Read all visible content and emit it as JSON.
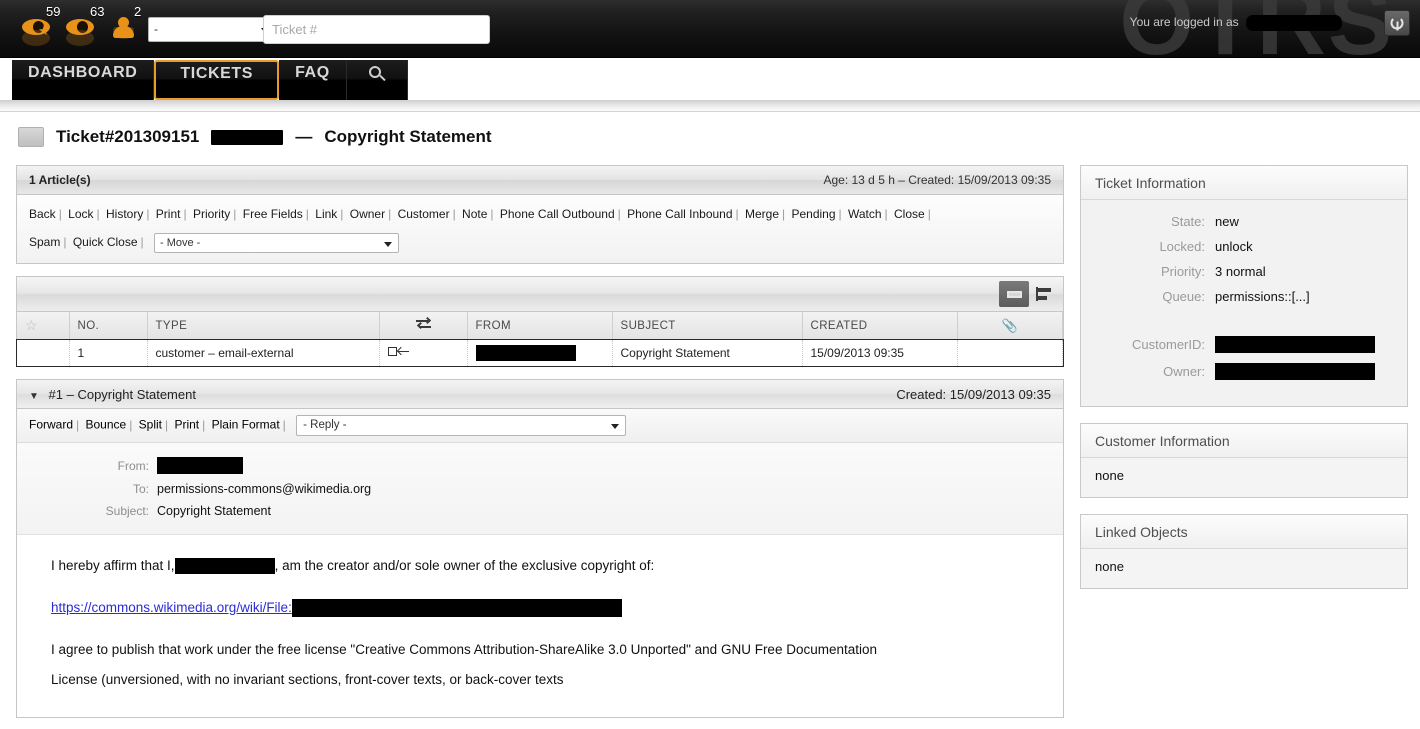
{
  "header": {
    "watermark": "OTRS",
    "toolbar_counts": [
      {
        "icon": "watched-tickets-icon",
        "count": "59"
      },
      {
        "icon": "seen-tickets-icon",
        "count": "63"
      },
      {
        "icon": "my-tickets-icon",
        "count": "2"
      }
    ],
    "queue_select_value": "-",
    "ticket_search_placeholder": "Ticket #",
    "ticket_search_value": "",
    "logged_in_label": "You are logged in as",
    "logged_in_user": "[redacted]"
  },
  "nav": {
    "items": [
      {
        "label": "DASHBOARD",
        "active": false
      },
      {
        "label": "TICKETS",
        "active": true
      },
      {
        "label": "FAQ",
        "active": false
      }
    ],
    "search_label": "Search"
  },
  "page_title": {
    "ticket_prefix": "Ticket#201309151",
    "redacted": "[redacted]",
    "dash": "—",
    "subject": "Copyright Statement"
  },
  "article_widget": {
    "count_label": "1 Article(s)",
    "age_created": "Age: 13 d 5 h – Created: 15/09/2013 09:35",
    "actions_row1": [
      "Back",
      "Lock",
      "History",
      "Print",
      "Priority",
      "Free Fields",
      "Link",
      "Owner",
      "Customer",
      "Note",
      "Phone Call Outbound",
      "Phone Call Inbound",
      "Merge",
      "Pending",
      "Watch",
      "Close"
    ],
    "actions_row2": [
      "Spam",
      "Quick Close"
    ],
    "move_select_value": "- Move -"
  },
  "article_table": {
    "columns": [
      "",
      "NO.",
      "TYPE",
      "",
      "FROM",
      "SUBJECT",
      "CREATED",
      ""
    ],
    "column_icons": [
      "star-icon",
      "",
      "",
      "exchange-icon",
      "",
      "",
      "",
      "paperclip-icon"
    ],
    "rows": [
      {
        "no": "1",
        "type": "customer – email-external",
        "direction_icon": "incoming-message-icon",
        "from": "[redacted]",
        "subject": "Copyright Statement",
        "created": "15/09/2013 09:35",
        "attachment": ""
      }
    ]
  },
  "article_detail": {
    "title": "#1 – Copyright Statement",
    "created": "Created: 15/09/2013 09:35",
    "actions": [
      "Forward",
      "Bounce",
      "Split",
      "Print",
      "Plain Format"
    ],
    "reply_select_value": "- Reply -",
    "fields": [
      {
        "label": "From:",
        "value": "[redacted]",
        "redacted": true
      },
      {
        "label": "To:",
        "value": "permissions-commons@wikimedia.org",
        "redacted": false
      },
      {
        "label": "Subject:",
        "value": "Copyright Statement",
        "redacted": false
      }
    ],
    "body": {
      "line1_pre": "I hereby affirm that I,",
      "line1_post": ", am the creator and/or sole owner of the exclusive copyright of:",
      "link_text": "https://commons.wikimedia.org/wiki/File:",
      "line3": "I agree to publish that work under the free license \"Creative Commons Attribution-ShareAlike 3.0 Unported\" and GNU Free Documentation",
      "line4": "License (unversioned, with no invariant sections, front-cover texts, or back-cover texts"
    }
  },
  "sidebar": {
    "ticket_information": {
      "title": "Ticket Information",
      "rows": [
        {
          "label": "State:",
          "value": "new",
          "redacted": false
        },
        {
          "label": "Locked:",
          "value": "unlock",
          "redacted": false
        },
        {
          "label": "Priority:",
          "value": "3 normal",
          "redacted": false
        },
        {
          "label": "Queue:",
          "value": "permissions::[...]",
          "redacted": false
        }
      ],
      "rows2": [
        {
          "label": "CustomerID:",
          "value": "[redacted]",
          "redacted": true
        },
        {
          "label": "Owner:",
          "value": "[redacted]",
          "redacted": true
        }
      ]
    },
    "customer_information": {
      "title": "Customer Information",
      "value": "none"
    },
    "linked_objects": {
      "title": "Linked Objects",
      "value": "none"
    }
  },
  "colors": {
    "accent_orange": "#eb9c28",
    "header_dark": "#141414",
    "link_blue": "#2b2bd6"
  }
}
